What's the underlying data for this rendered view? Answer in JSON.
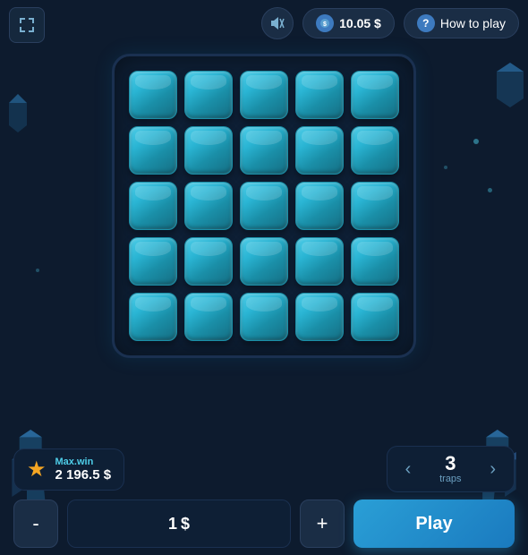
{
  "header": {
    "mute_icon": "🔇",
    "balance": "10.05 $",
    "how_to_play": "How to play",
    "fullscreen_icon": "⛶"
  },
  "grid": {
    "rows": 5,
    "cols": 5,
    "cells": 25
  },
  "max_win": {
    "label": "Max.win",
    "value": "2 196.5 $",
    "star": "★"
  },
  "traps": {
    "label": "traps",
    "value": "3",
    "prev_icon": "‹",
    "next_icon": "›"
  },
  "bet": {
    "minus_label": "-",
    "plus_label": "+",
    "value": "1",
    "currency": "$",
    "play_label": "Play"
  }
}
